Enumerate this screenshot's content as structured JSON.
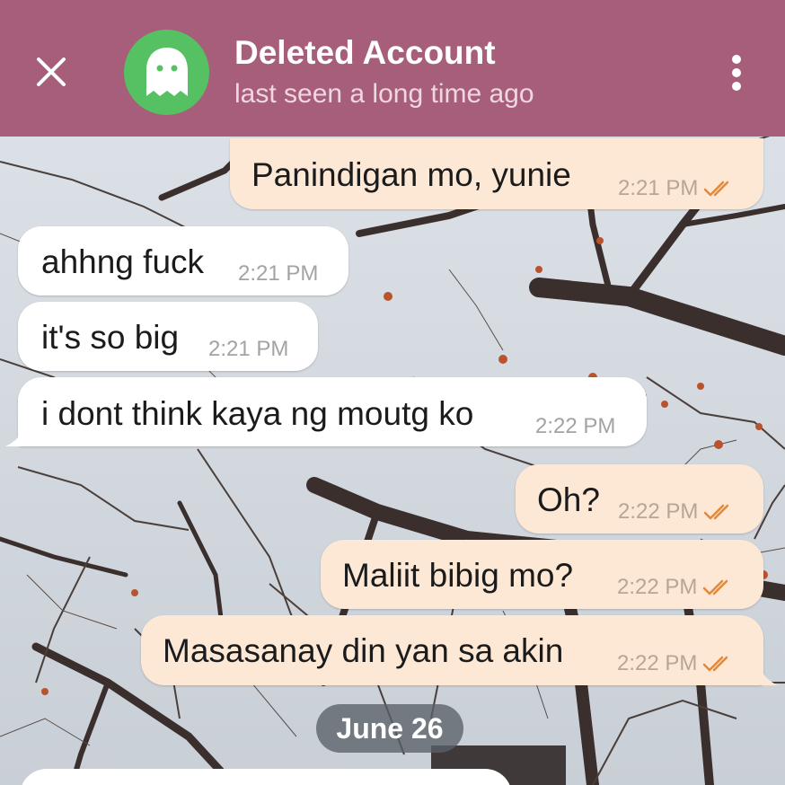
{
  "header": {
    "title": "Deleted Account",
    "subtitle": "last seen a long time ago",
    "close_icon": "close-icon",
    "avatar_icon": "ghost-icon",
    "menu_icon": "more-vertical-icon",
    "bar_color": "#a65e7a",
    "avatar_color": "#56c163"
  },
  "messages": [
    {
      "direction": "outgoing",
      "text": "Panindigan mo, yunie",
      "time": "2:21 PM",
      "status": "read"
    },
    {
      "direction": "incoming",
      "text": "ahhng fuck",
      "time": "2:21 PM"
    },
    {
      "direction": "incoming",
      "text": "it's so big",
      "time": "2:21 PM"
    },
    {
      "direction": "incoming",
      "text": "i dont think kaya ng moutg ko",
      "time": "2:22 PM"
    },
    {
      "direction": "outgoing",
      "text": "Oh?",
      "time": "2:22 PM",
      "status": "read"
    },
    {
      "direction": "outgoing",
      "text": "Maliit bibig mo?",
      "time": "2:22 PM",
      "status": "read"
    },
    {
      "direction": "outgoing",
      "text": "Masasanay din yan sa akin",
      "time": "2:22 PM",
      "status": "read"
    }
  ],
  "date_separator": "June 26",
  "colors": {
    "incoming_bubble": "#ffffff",
    "outgoing_bubble": "#fde8d6",
    "read_check": "#e38a3a"
  }
}
